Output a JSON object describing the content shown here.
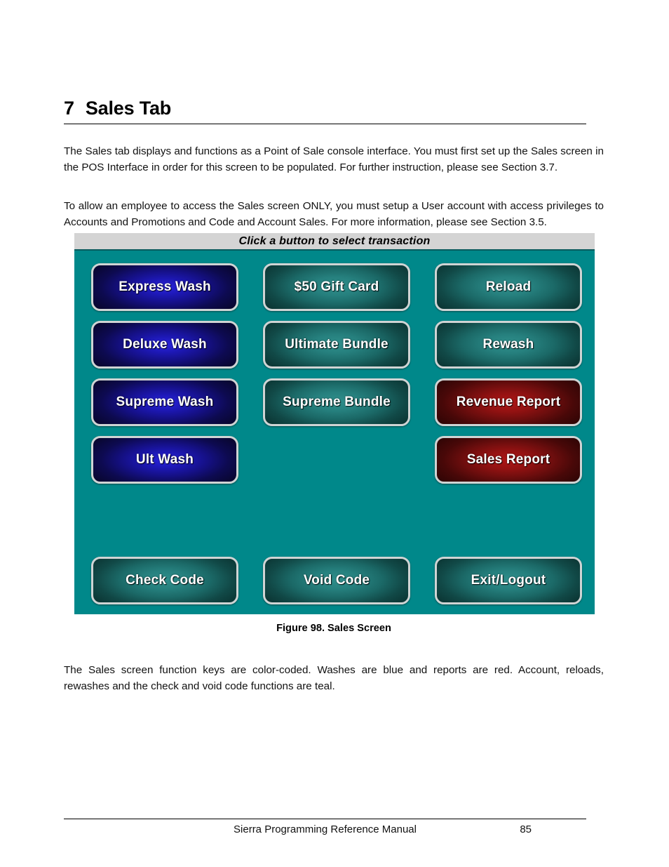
{
  "heading": {
    "number": "7",
    "title": "Sales Tab"
  },
  "paragraphs": {
    "intro": "The Sales tab displays and functions as a Point of Sale console interface. You must first set up the Sales screen in the POS Interface in order for this screen to be populated. For further instruction, please see Section 3.7.",
    "access": "To allow an employee to access the Sales screen ONLY, you must setup a User account with access privileges to Accounts and Promotions and Code and Account Sales. For more information, please see Section 3.5.",
    "colors": "The Sales screen function keys are color-coded. Washes are blue and reports are red. Account, reloads, rewashes and the check and void code functions are teal."
  },
  "figure": {
    "caption": "Figure 98. Sales Screen",
    "pos_screen": {
      "titlebar_text": "Click a button to select transaction",
      "background_color": "#00888a",
      "titlebar_color": "#d4d4d4",
      "color_legend": {
        "wash": "#1d18b4",
        "report": "#941212",
        "account": "#26807e"
      },
      "buttons": [
        {
          "label": "Express Wash",
          "color": "blue",
          "col": 0,
          "row": 0
        },
        {
          "label": "$50 Gift Card",
          "color": "teal",
          "col": 1,
          "row": 0
        },
        {
          "label": "Reload",
          "color": "teal",
          "col": 2,
          "row": 0
        },
        {
          "label": "Deluxe Wash",
          "color": "blue",
          "col": 0,
          "row": 1
        },
        {
          "label": "Ultimate Bundle",
          "color": "teal",
          "col": 1,
          "row": 1
        },
        {
          "label": "Rewash",
          "color": "teal",
          "col": 2,
          "row": 1
        },
        {
          "label": "Supreme Wash",
          "color": "blue",
          "col": 0,
          "row": 2
        },
        {
          "label": "Supreme Bundle",
          "color": "teal",
          "col": 1,
          "row": 2
        },
        {
          "label": "Revenue Report",
          "color": "red",
          "col": 2,
          "row": 2
        },
        {
          "label": "Ult Wash",
          "color": "blue",
          "col": 0,
          "row": 3
        },
        {
          "label": "Sales Report",
          "color": "red",
          "col": 2,
          "row": 3
        },
        {
          "label": "Check Code",
          "color": "teal",
          "col": 0,
          "row": 5
        },
        {
          "label": "Void Code",
          "color": "teal",
          "col": 1,
          "row": 5
        },
        {
          "label": "Exit/Logout",
          "color": "teal",
          "col": 2,
          "row": 5
        }
      ]
    }
  },
  "footer": {
    "title": "Sierra Programming Reference Manual",
    "page_number": "85"
  }
}
